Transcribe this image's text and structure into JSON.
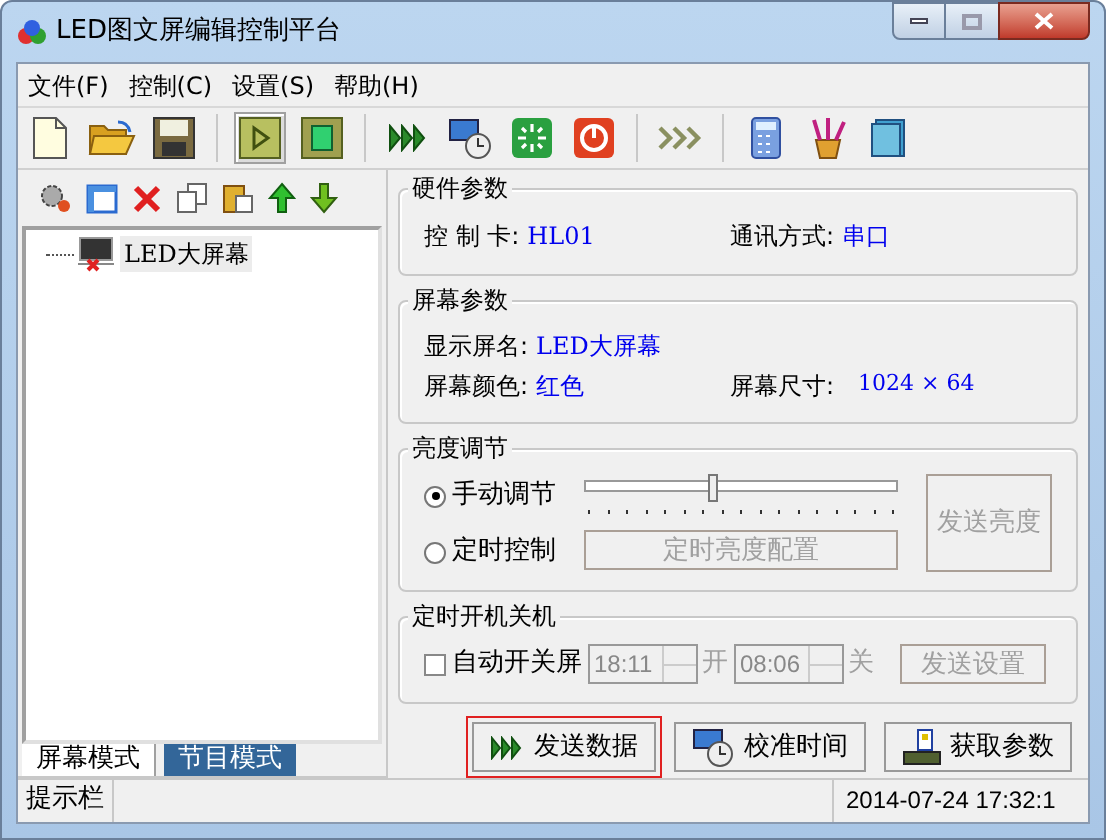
{
  "window": {
    "title": "LED图文屏编辑控制平台"
  },
  "menu": [
    {
      "label": "文件(F)"
    },
    {
      "label": "控制(C)"
    },
    {
      "label": "设置(S)"
    },
    {
      "label": "帮助(H)"
    }
  ],
  "toolbar": [
    {
      "buttons": [
        {
          "kind": "new",
          "pressed": false
        },
        {
          "kind": "open",
          "pressed": false
        },
        {
          "kind": "save",
          "pressed": false
        }
      ]
    },
    {
      "buttons": [
        {
          "kind": "play",
          "pressed": true
        },
        {
          "kind": "stop",
          "pressed": false
        }
      ]
    },
    {
      "buttons": [
        {
          "kind": "send",
          "pressed": false
        },
        {
          "kind": "clock",
          "pressed": false
        },
        {
          "kind": "reset",
          "pressed": false
        },
        {
          "kind": "power",
          "pressed": false
        }
      ]
    },
    {
      "buttons": [
        {
          "kind": "forward",
          "pressed": false
        }
      ]
    },
    {
      "buttons": [
        {
          "kind": "calculator",
          "pressed": false
        },
        {
          "kind": "paint",
          "pressed": false
        },
        {
          "kind": "book",
          "pressed": false
        }
      ]
    }
  ],
  "tree": [
    {
      "label": "LED大屏幕",
      "selected": true
    }
  ],
  "left_tabs": [
    {
      "label": "屏幕模式",
      "selected": true
    },
    {
      "label": "节目模式",
      "selected": false
    }
  ],
  "hardware": {
    "title": "硬件参数",
    "fields": [
      {
        "label": "控 制 卡:",
        "value": "HL01"
      },
      {
        "label": "通讯方式:",
        "value": "串口"
      }
    ]
  },
  "screen": {
    "title": "屏幕参数",
    "name": {
      "label": "显示屏名:",
      "value": "LED大屏幕"
    },
    "fields": [
      {
        "label": "屏幕颜色:",
        "value": "红色"
      },
      {
        "label": "屏幕尺寸:",
        "value": "1024 × 64"
      }
    ]
  },
  "brightness": {
    "title": "亮度调节",
    "options": [
      {
        "label": "手动调节",
        "selected": true
      },
      {
        "label": "定时控制",
        "selected": false
      }
    ],
    "level": 0.41,
    "schedule_button": {
      "label": "定时亮度配置",
      "disabled": true
    },
    "send_button": {
      "label": "发送亮度",
      "disabled": true
    }
  },
  "timer": {
    "title": "定时开机关机",
    "checkbox": {
      "label": "自动开关屏",
      "checked": false
    },
    "on_time": "18:11",
    "on_label": "开",
    "off_time": "08:06",
    "off_label": "关",
    "send_button": {
      "label": "发送设置",
      "disabled": true
    }
  },
  "actions": [
    {
      "kind": "send",
      "label": "发送数据",
      "focused": true
    },
    {
      "kind": "clock",
      "label": "校准时间",
      "focused": false
    },
    {
      "kind": "fetch",
      "label": "获取参数",
      "focused": false
    }
  ],
  "status_bar": {
    "hint": "提示栏",
    "datetime": "2014-07-24 17:32:1"
  }
}
